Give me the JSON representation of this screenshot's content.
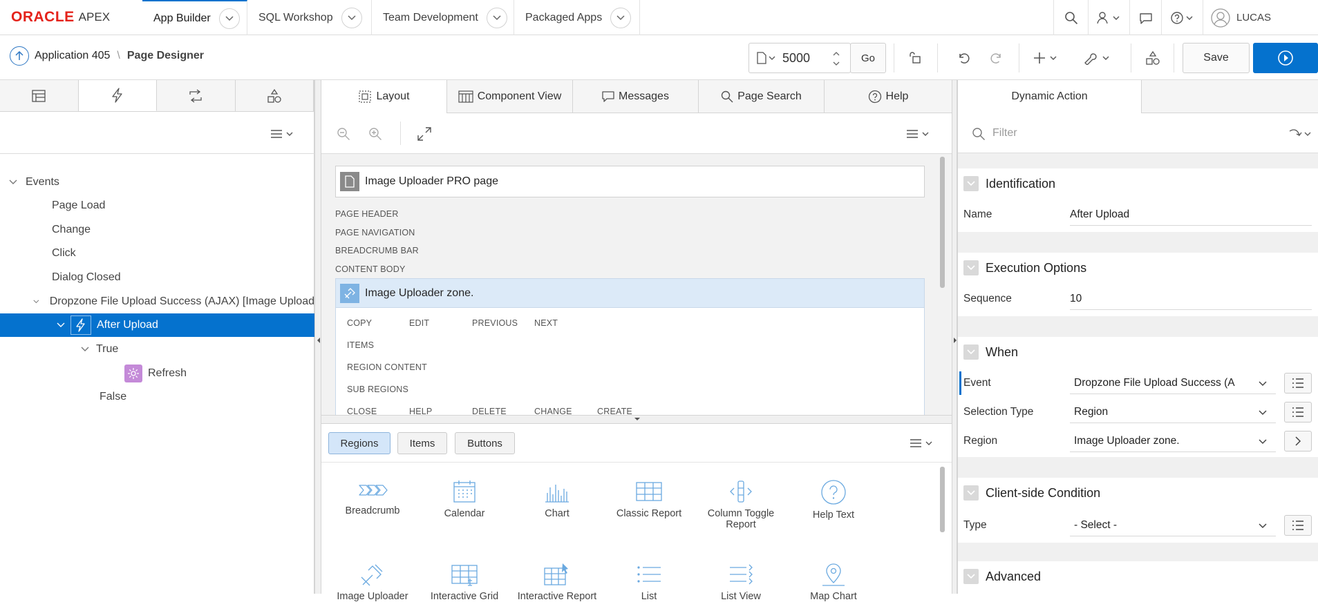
{
  "topnav": {
    "logo_oracle": "ORACLE",
    "logo_apex": "APEX",
    "tabs": [
      "App Builder",
      "SQL Workshop",
      "Team Development",
      "Packaged Apps"
    ],
    "user": "LUCAS"
  },
  "toolbar": {
    "app_label": "Application 405",
    "page_designer": "Page Designer",
    "page_number": "5000",
    "go_label": "Go",
    "save_label": "Save"
  },
  "left": {
    "tree": {
      "events": "Events",
      "page_load": "Page Load",
      "change": "Change",
      "click": "Click",
      "dialog_closed": "Dialog Closed",
      "dropzone": "Dropzone File Upload Success (AJAX) [Image Upload",
      "after_upload": "After Upload",
      "true_label": "True",
      "refresh": "Refresh",
      "false_label": "False"
    }
  },
  "center": {
    "tabs": [
      "Layout",
      "Component View",
      "Messages",
      "Page Search",
      "Help"
    ],
    "page_title": "Image Uploader PRO page",
    "sections": [
      "PAGE HEADER",
      "PAGE NAVIGATION",
      "BREADCRUMB BAR",
      "CONTENT BODY"
    ],
    "region_title": "Image Uploader zone.",
    "region_row1": [
      "COPY",
      "EDIT",
      "PREVIOUS",
      "NEXT"
    ],
    "region_items": "ITEMS",
    "region_content": "REGION CONTENT",
    "region_sub": "SUB REGIONS",
    "region_row2": [
      "CLOSE",
      "HELP",
      "DELETE",
      "CHANGE",
      "CREATE"
    ],
    "gallery_tabs": [
      "Regions",
      "Items",
      "Buttons"
    ],
    "gallery_items": [
      "Breadcrumb",
      "Calendar",
      "Chart",
      "Classic Report",
      "Column Toggle Report",
      "Help Text",
      "Image Uploader",
      "Interactive Grid",
      "Interactive Report",
      "List",
      "List View",
      "Map Chart"
    ]
  },
  "right": {
    "tab": "Dynamic Action",
    "filter_placeholder": "Filter",
    "identification": "Identification",
    "name_label": "Name",
    "name_value": "After Upload",
    "execution": "Execution Options",
    "sequence_label": "Sequence",
    "sequence_value": "10",
    "when": "When",
    "event_label": "Event",
    "event_value": "Dropzone File Upload Success (A",
    "selection_type_label": "Selection Type",
    "selection_type_value": "Region",
    "region_label": "Region",
    "region_value": "Image Uploader zone.",
    "client_condition": "Client-side Condition",
    "type_label": "Type",
    "type_value": "- Select -",
    "advanced": "Advanced"
  },
  "colors": {
    "accent": "#0572ce",
    "oracle_red": "#e4231b",
    "region_highlight": "#dceaf8",
    "refresh_icon": "#c48ad8"
  }
}
